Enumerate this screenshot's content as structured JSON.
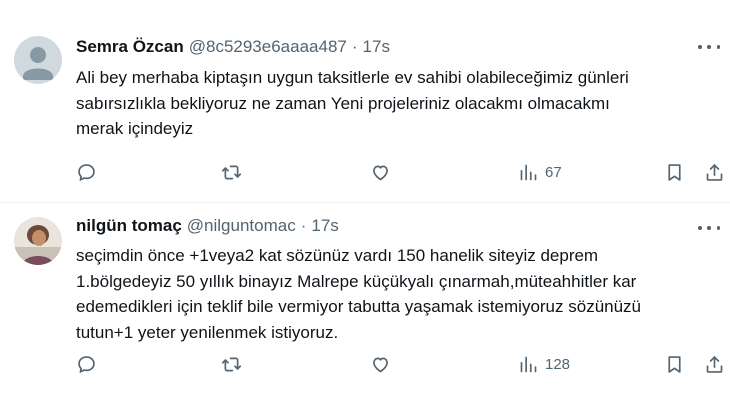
{
  "tweets": [
    {
      "name": "Semra Özcan",
      "handle": "@8c5293e6aaaa487",
      "dot": "·",
      "time": "17s",
      "lines": [
        "Ali bey merhaba kiptaşın uygun taksitlerle ev sahibi olabileceğimiz günleri",
        "sabırsızlıkla bekliyoruz ne zaman Yeni projeleriniz olacakmı olmacakmı",
        "merak içindeyiz"
      ],
      "views": "67"
    },
    {
      "name": "nilgün tomaç",
      "handle": "@nilguntomac",
      "dot": "·",
      "time": "17s",
      "lines": [
        "seçimdin önce +1veya2 kat sözünüz vardı 150 hanelik siteyiz deprem",
        "1.bölgedeyiz 50 yıllık binayız Malrepe küçükyalı  çınarmah,müteahhitler kar",
        "edemedikleri için teklif bile vermiyor tabutta yaşamak istemiyoruz sözünüzü",
        "tutun+1 yeter yenilenmek istiyoruz."
      ],
      "views": "128"
    }
  ],
  "icons": {
    "reply": "reply-icon",
    "retweet": "retweet-icon",
    "like": "heart-icon",
    "views": "views-icon",
    "bookmark": "bookmark-icon",
    "share": "share-icon",
    "more": "more-icon"
  },
  "colors": {
    "text": "#0f1419",
    "secondary": "#536471",
    "divider": "#eff3f4"
  }
}
